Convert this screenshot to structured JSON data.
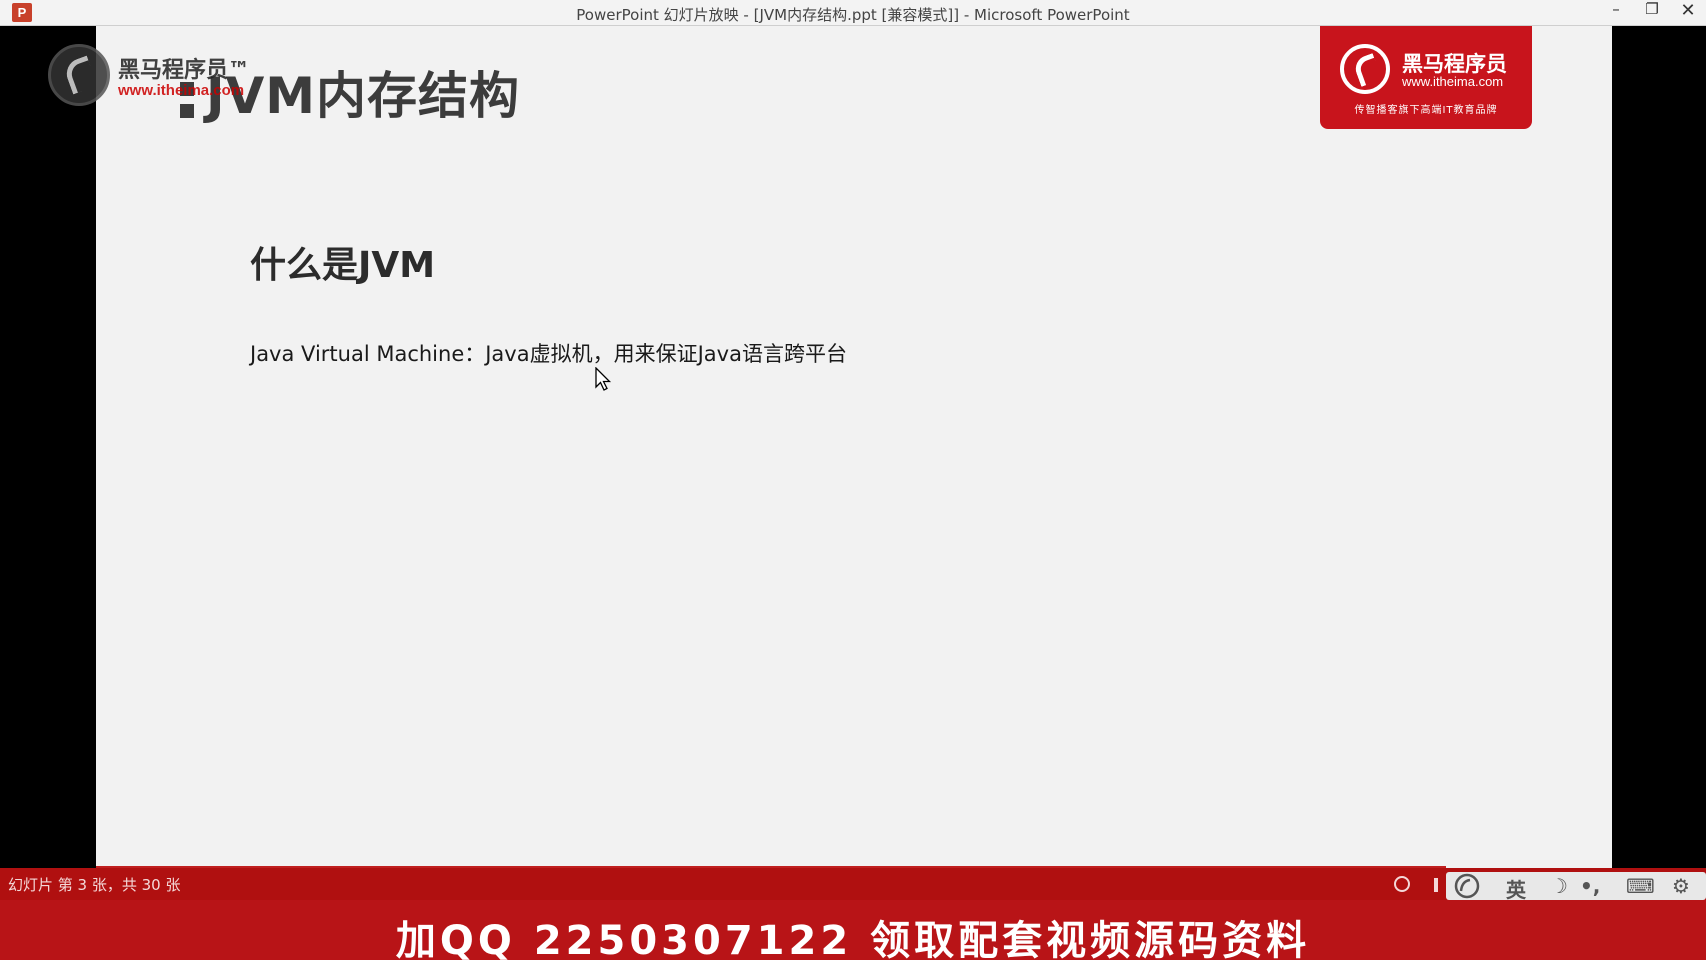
{
  "window": {
    "app_icon": "P",
    "title": "PowerPoint 幻灯片放映 - [JVM内存结构.ppt [兼容模式]] - Microsoft PowerPoint",
    "minimize": "–",
    "maximize": "❐",
    "close": "✕"
  },
  "slide": {
    "title": "JVM内存结构",
    "heading": "什么是JVM",
    "body": "Java Virtual Machine：Java虚拟机，用来保证Java语言跨平台",
    "logo": {
      "name": "黑马程序员",
      "url": "www.itheima.com",
      "slogan": "传智播客旗下高端IT教育品牌"
    }
  },
  "watermark": {
    "name": "黑马程序员™",
    "url": "www.itheima.com"
  },
  "statusbar": {
    "slide_info": "幻灯片 第 3 张，共 30 张"
  },
  "ime": {
    "lang": "英",
    "moon": "☽",
    "punct": "•,",
    "keyboard": "⌨",
    "settings": "⚙"
  },
  "banner": {
    "text": "加QQ 2250307122  领取配套视频源码资料"
  },
  "colors": {
    "brand_red": "#c8141c",
    "banner_red": "#b81417",
    "slide_bg": "#f2f2f2"
  }
}
